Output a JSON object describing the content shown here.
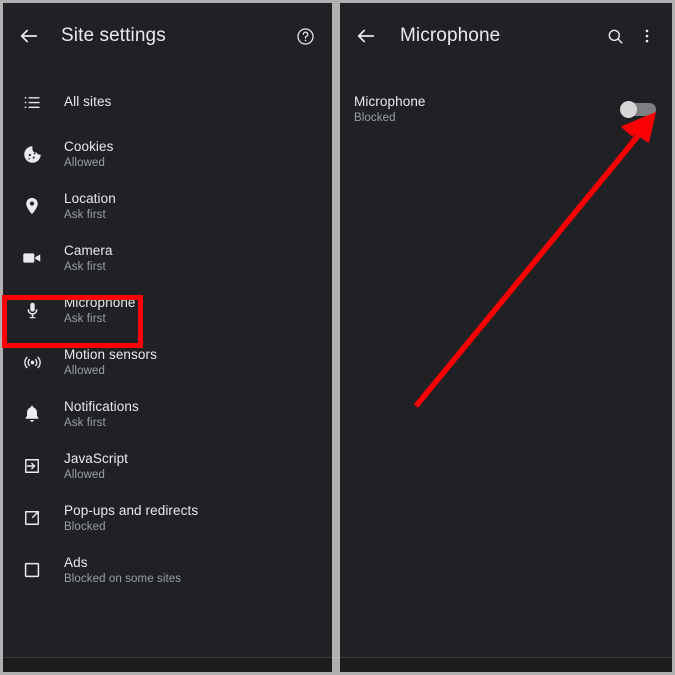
{
  "theme": {
    "background": "#b0b0b0",
    "panel_bg": "#202124",
    "text_primary": "#e8eaed",
    "text_secondary": "#9aa0a6",
    "annotation_red": "#fc0004",
    "switch_knob": "#d6d6d6",
    "switch_track": "#7d7f82"
  },
  "left_panel": {
    "appbar": {
      "back_icon": "back-arrow-icon",
      "title": "Site settings",
      "help_icon": "help-circle-icon"
    },
    "items": [
      {
        "icon": "list-icon",
        "title": "All sites",
        "subtitle": ""
      },
      {
        "icon": "cookie-icon",
        "title": "Cookies",
        "subtitle": "Allowed"
      },
      {
        "icon": "location-pin-icon",
        "title": "Location",
        "subtitle": "Ask first"
      },
      {
        "icon": "video-camera-icon",
        "title": "Camera",
        "subtitle": "Ask first"
      },
      {
        "icon": "microphone-icon",
        "title": "Microphone",
        "subtitle": "Ask first"
      },
      {
        "icon": "motion-sensors-icon",
        "title": "Motion sensors",
        "subtitle": "Allowed"
      },
      {
        "icon": "bell-icon",
        "title": "Notifications",
        "subtitle": "Ask first"
      },
      {
        "icon": "javascript-icon",
        "title": "JavaScript",
        "subtitle": "Allowed"
      },
      {
        "icon": "popup-redirect-icon",
        "title": "Pop-ups and redirects",
        "subtitle": "Blocked"
      },
      {
        "icon": "ads-icon",
        "title": "Ads",
        "subtitle": "Blocked on some sites"
      }
    ]
  },
  "right_panel": {
    "appbar": {
      "back_icon": "back-arrow-icon",
      "title": "Microphone",
      "search_icon": "search-icon",
      "more_icon": "more-vertical-icon"
    },
    "toggle_row": {
      "title": "Microphone",
      "subtitle": "Blocked",
      "switch_state": "off"
    }
  },
  "annotations": {
    "highlight_box_target": "Microphone",
    "arrow_target": "microphone-toggle-switch"
  }
}
